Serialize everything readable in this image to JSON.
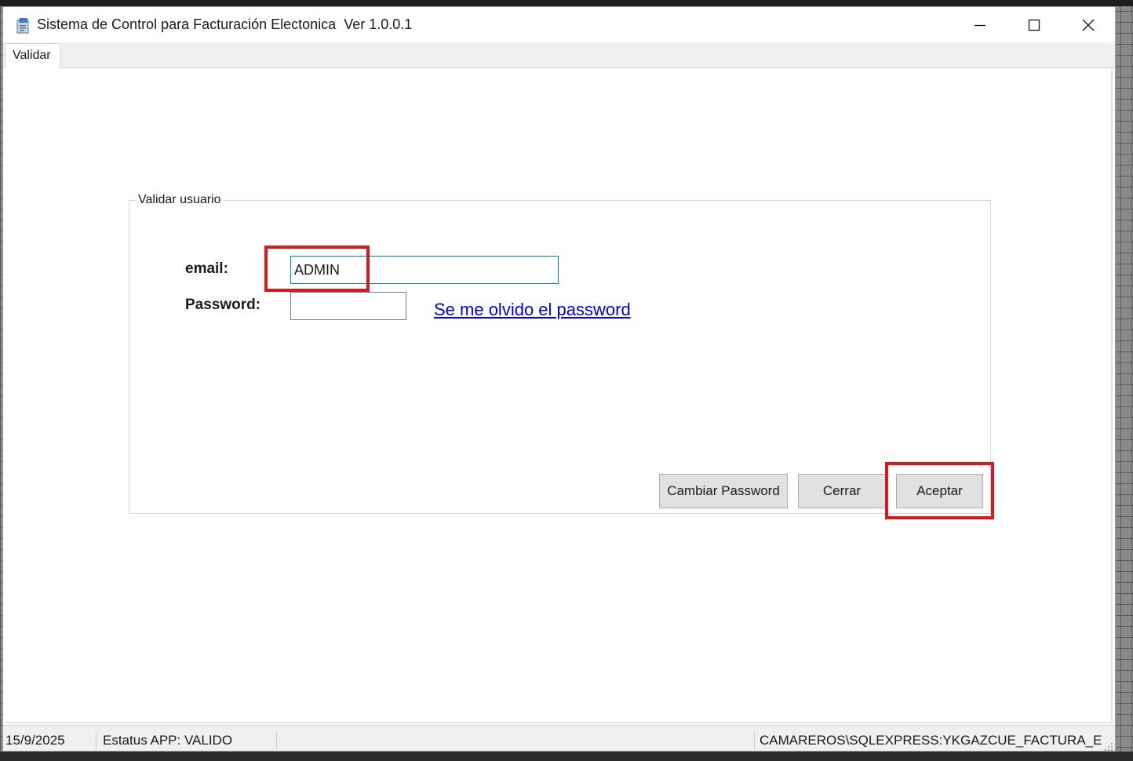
{
  "window": {
    "title": "Sistema de Control para Facturación Electonica  Ver 1.0.0.1",
    "buttons": [
      "minimize-icon",
      "maximize-icon",
      "close-icon"
    ]
  },
  "tabs": [
    {
      "label": "Validar",
      "selected": true
    }
  ],
  "group": {
    "title": "Validar usuario",
    "email_label": "email:",
    "email_value": "ADMIN",
    "password_label": "Password:",
    "password_value": "",
    "forgot_link": "Se me olvido el password"
  },
  "buttons": {
    "cambiar": "Cambiar Password",
    "cerrar": "Cerrar",
    "aceptar": "Aceptar"
  },
  "statusbar": {
    "date": "15/9/2025",
    "status": "Estatus APP: VALIDO",
    "db": "CAMAREROS\\SQLEXPRESS:YKGAZCUE_FACTURA_E"
  },
  "colors": {
    "highlight": "#e0161b",
    "link": "#0000ee",
    "focus_border": "#0078d7",
    "button_face": "#e1e1e1"
  }
}
